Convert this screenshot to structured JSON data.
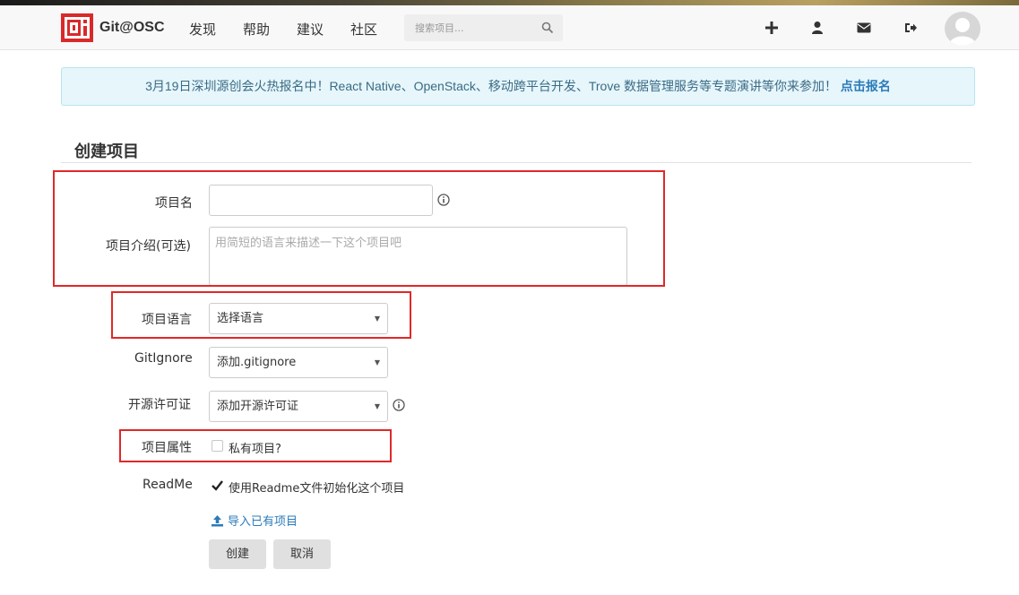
{
  "navbar": {
    "brand": "Git@OSC",
    "links": [
      "发现",
      "帮助",
      "建议",
      "社区"
    ],
    "search_placeholder": "搜索项目...",
    "icons": [
      "plus-icon",
      "user-icon",
      "envelope-icon",
      "sign-out-icon"
    ]
  },
  "banner": {
    "text": "3月19日深圳源创会火热报名中！React Native、OpenStack、移动跨平台开发、Trove 数据管理服务等专题演讲等你来参加！",
    "link": "点击报名"
  },
  "form": {
    "title": "创建项目",
    "name_label": "项目名",
    "desc_label": "项目介绍(可选)",
    "desc_placeholder": "用简短的语言来描述一下这个项目吧",
    "language_label": "项目语言",
    "language_value": "选择语言",
    "gitignore_label": "GitIgnore",
    "gitignore_value": "添加.gitignore",
    "license_label": "开源许可证",
    "license_value": "添加开源许可证",
    "property_label": "项目属性",
    "private_label": "私有项目?",
    "private_checked": false,
    "readme_label": "ReadMe",
    "readme_text": "使用Readme文件初始化这个项目",
    "readme_checked": true,
    "import_link": "导入已有项目",
    "create_button": "创建",
    "cancel_button": "取消"
  },
  "colors": {
    "annotation": "#e02828",
    "link": "#2b7bb9",
    "logo": "#d9292a"
  }
}
